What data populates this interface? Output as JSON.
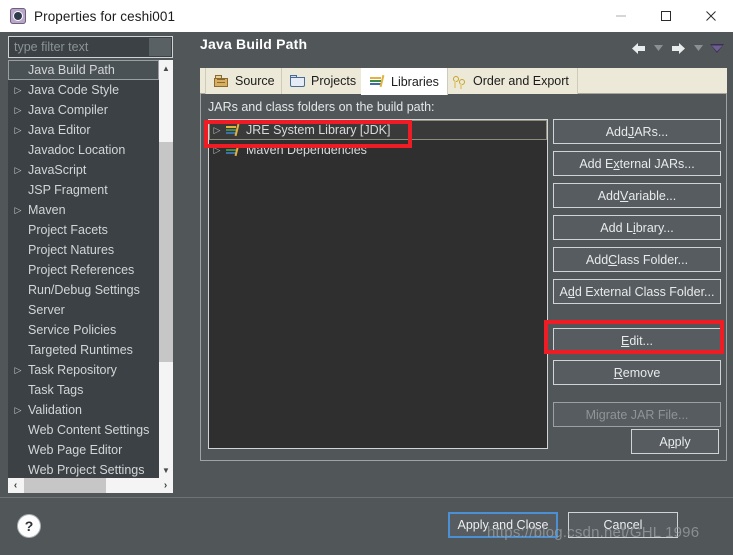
{
  "window": {
    "title": "Properties for ceshi001",
    "icon": "properties-gear-icon",
    "controls": {
      "minimize": "minimize-icon",
      "maximize": "maximize-icon",
      "close": "close-icon"
    }
  },
  "filter": {
    "placeholder": "type filter text",
    "value": ""
  },
  "sidebar": {
    "items": [
      {
        "label": "Java Build Path",
        "expandable": false,
        "selected": true
      },
      {
        "label": "Java Code Style",
        "expandable": true,
        "selected": false
      },
      {
        "label": "Java Compiler",
        "expandable": true,
        "selected": false
      },
      {
        "label": "Java Editor",
        "expandable": true,
        "selected": false
      },
      {
        "label": "Javadoc Location",
        "expandable": false,
        "selected": false
      },
      {
        "label": "JavaScript",
        "expandable": true,
        "selected": false
      },
      {
        "label": "JSP Fragment",
        "expandable": false,
        "selected": false
      },
      {
        "label": "Maven",
        "expandable": true,
        "selected": false
      },
      {
        "label": "Project Facets",
        "expandable": false,
        "selected": false
      },
      {
        "label": "Project Natures",
        "expandable": false,
        "selected": false
      },
      {
        "label": "Project References",
        "expandable": false,
        "selected": false
      },
      {
        "label": "Run/Debug Settings",
        "expandable": false,
        "selected": false
      },
      {
        "label": "Server",
        "expandable": false,
        "selected": false
      },
      {
        "label": "Service Policies",
        "expandable": false,
        "selected": false
      },
      {
        "label": "Targeted Runtimes",
        "expandable": false,
        "selected": false
      },
      {
        "label": "Task Repository",
        "expandable": true,
        "selected": false
      },
      {
        "label": "Task Tags",
        "expandable": false,
        "selected": false
      },
      {
        "label": "Validation",
        "expandable": true,
        "selected": false
      },
      {
        "label": "Web Content Settings",
        "expandable": false,
        "selected": false
      },
      {
        "label": "Web Page Editor",
        "expandable": false,
        "selected": false
      },
      {
        "label": "Web Project Settings",
        "expandable": false,
        "selected": false
      }
    ]
  },
  "header": {
    "page_title": "Java Build Path",
    "nav": {
      "back": "back-arrow-icon",
      "back_menu": "chevron-down-icon",
      "forward": "forward-arrow-icon",
      "forward_menu": "chevron-down-icon",
      "view_menu": "view-menu-triangle-icon"
    }
  },
  "tabs": [
    {
      "label": "Source",
      "icon": "source-folder-icon",
      "active": false
    },
    {
      "label": "Projects",
      "icon": "projects-folder-icon",
      "active": false
    },
    {
      "label": "Libraries",
      "icon": "libraries-books-icon",
      "active": true
    },
    {
      "label": "Order and Export",
      "icon": "order-export-icon",
      "active": false
    }
  ],
  "main": {
    "list_label": "JARs and class folders on the build path:",
    "entries": [
      {
        "label": "JRE System Library [JDK]",
        "icon": "library-icon",
        "expandable": true,
        "selected": true
      },
      {
        "label": "Maven Dependencies",
        "icon": "library-icon",
        "expandable": true,
        "selected": false
      }
    ],
    "side_buttons": [
      {
        "label": "Add JARs...",
        "mnemonic": "J",
        "enabled": true
      },
      {
        "label": "Add External JARs...",
        "mnemonic": "x",
        "enabled": true
      },
      {
        "label": "Add Variable...",
        "mnemonic": "V",
        "enabled": true
      },
      {
        "label": "Add Library...",
        "mnemonic": "i",
        "enabled": true
      },
      {
        "label": "Add Class Folder...",
        "mnemonic": "C",
        "enabled": true
      },
      {
        "label": "Add External Class Folder...",
        "mnemonic": "d",
        "enabled": true
      },
      {
        "label": "Edit...",
        "mnemonic": "E",
        "enabled": true
      },
      {
        "label": "Remove",
        "mnemonic": "R",
        "enabled": true
      },
      {
        "label": "Migrate JAR File...",
        "mnemonic": "",
        "enabled": false
      }
    ],
    "apply_label": "Apply",
    "apply_mnemonic": "p"
  },
  "footer": {
    "help_icon": "help-question-icon",
    "apply_and_close": "Apply and Close",
    "cancel": "Cancel"
  },
  "watermark": "https://blog.csdn.net/GHL 1996",
  "annotations": [
    {
      "name": "jre-system-library-highlight",
      "color": "#ee1c24"
    },
    {
      "name": "edit-button-highlight",
      "color": "#ee1c24"
    }
  ]
}
